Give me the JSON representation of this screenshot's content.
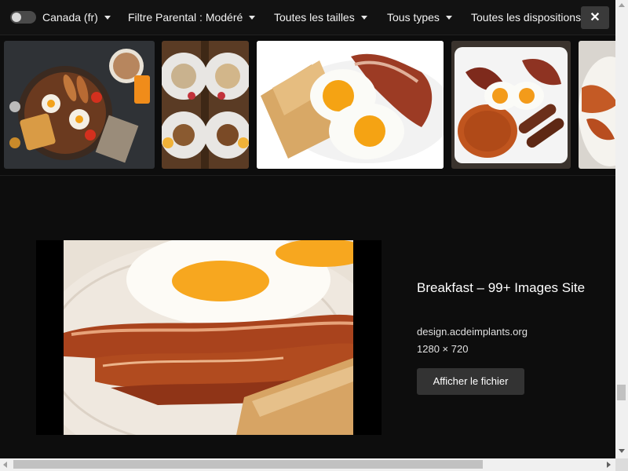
{
  "filters": {
    "safesearch_toggle": {
      "on": false
    },
    "region": "Canada (fr)",
    "parental": "Filtre Parental : Modéré",
    "size": "Toutes les tailles",
    "type": "Tous types",
    "layout": "Toutes les dispositions",
    "close_label": "✕"
  },
  "thumbnails": [
    {
      "subject": "full breakfast skillet with eggs, sausages, beans, toast and juice"
    },
    {
      "subject": "two plates of breakfast items arranged on wooden table"
    },
    {
      "subject": "fried eggs with bacon and toast on white plate",
      "selected": true
    },
    {
      "subject": "english breakfast with eggs, sausages and baked beans"
    },
    {
      "subject": "bacon and eggs partially visible"
    }
  ],
  "detail": {
    "title": "Breakfast – 99+ Images Site",
    "domain": "design.acdeimplants.org",
    "dimensions": "1280 × 720",
    "open_button": "Afficher le fichier"
  }
}
